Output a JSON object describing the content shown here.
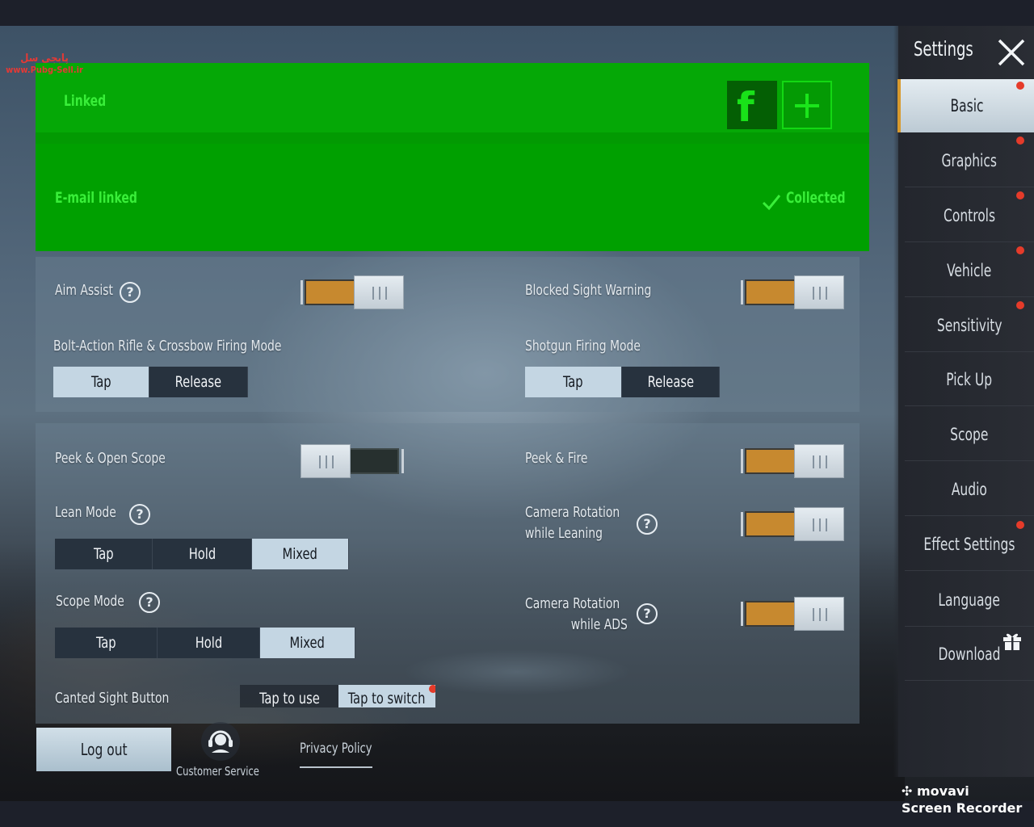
{
  "watermark": {
    "persian": "پابجی سل",
    "url": "www.Pubg-Sell.ir"
  },
  "account": {
    "linked_label": "Linked",
    "email_label": "E-mail linked",
    "collected_label": "Collected",
    "facebook_icon": "facebook-icon",
    "add_icon": "plus-icon"
  },
  "settings": {
    "aim_assist": {
      "label": "Aim Assist",
      "on": true
    },
    "blocked_sight": {
      "label": "Blocked Sight Warning",
      "on": true
    },
    "bolt_action": {
      "label": "Bolt-Action Rifle & Crossbow Firing Mode",
      "options": [
        "Tap",
        "Release"
      ],
      "selected": "Tap"
    },
    "shotgun": {
      "label": "Shotgun Firing Mode",
      "options": [
        "Tap",
        "Release"
      ],
      "selected": "Tap"
    },
    "peek_open_scope": {
      "label": "Peek & Open Scope",
      "on": false
    },
    "peek_fire": {
      "label": "Peek & Fire",
      "on": true
    },
    "lean_mode": {
      "label": "Lean Mode",
      "options": [
        "Tap",
        "Hold",
        "Mixed"
      ],
      "selected": "Mixed"
    },
    "camera_leaning": {
      "label_line1": "Camera Rotation",
      "label_line2": "while Leaning",
      "on": true
    },
    "scope_mode": {
      "label": "Scope Mode",
      "options": [
        "Tap",
        "Hold",
        "Mixed"
      ],
      "selected": "Mixed"
    },
    "camera_ads": {
      "label_line1": "Camera Rotation",
      "label_line2": "while ADS",
      "on": true
    },
    "canted_sight": {
      "label": "Canted Sight Button",
      "options": [
        "Tap to use",
        "Tap to switch"
      ],
      "selected": "Tap to switch"
    }
  },
  "footer": {
    "logout_label": "Log out",
    "customer_service_label": "Customer Service",
    "privacy_label": "Privacy Policy"
  },
  "sidebar": {
    "title": "Settings",
    "items": [
      {
        "label": "Basic",
        "active": true,
        "dot": true
      },
      {
        "label": "Graphics",
        "active": false,
        "dot": true
      },
      {
        "label": "Controls",
        "active": false,
        "dot": true
      },
      {
        "label": "Vehicle",
        "active": false,
        "dot": true
      },
      {
        "label": "Sensitivity",
        "active": false,
        "dot": true
      },
      {
        "label": "Pick Up",
        "active": false,
        "dot": false
      },
      {
        "label": "Scope",
        "active": false,
        "dot": false
      },
      {
        "label": "Audio",
        "active": false,
        "dot": false
      },
      {
        "label": "Effect Settings",
        "active": false,
        "dot": true
      },
      {
        "label": "Language",
        "active": false,
        "dot": false
      },
      {
        "label": "Download",
        "active": false,
        "dot": false
      }
    ]
  },
  "recorder": {
    "brand": "movavi",
    "product": "Screen Recorder"
  },
  "colors": {
    "accent_orange": "#c7892f",
    "account_green": "#05a806",
    "selected_option": "#c4d6e3",
    "notification_red": "#e53b2a"
  }
}
